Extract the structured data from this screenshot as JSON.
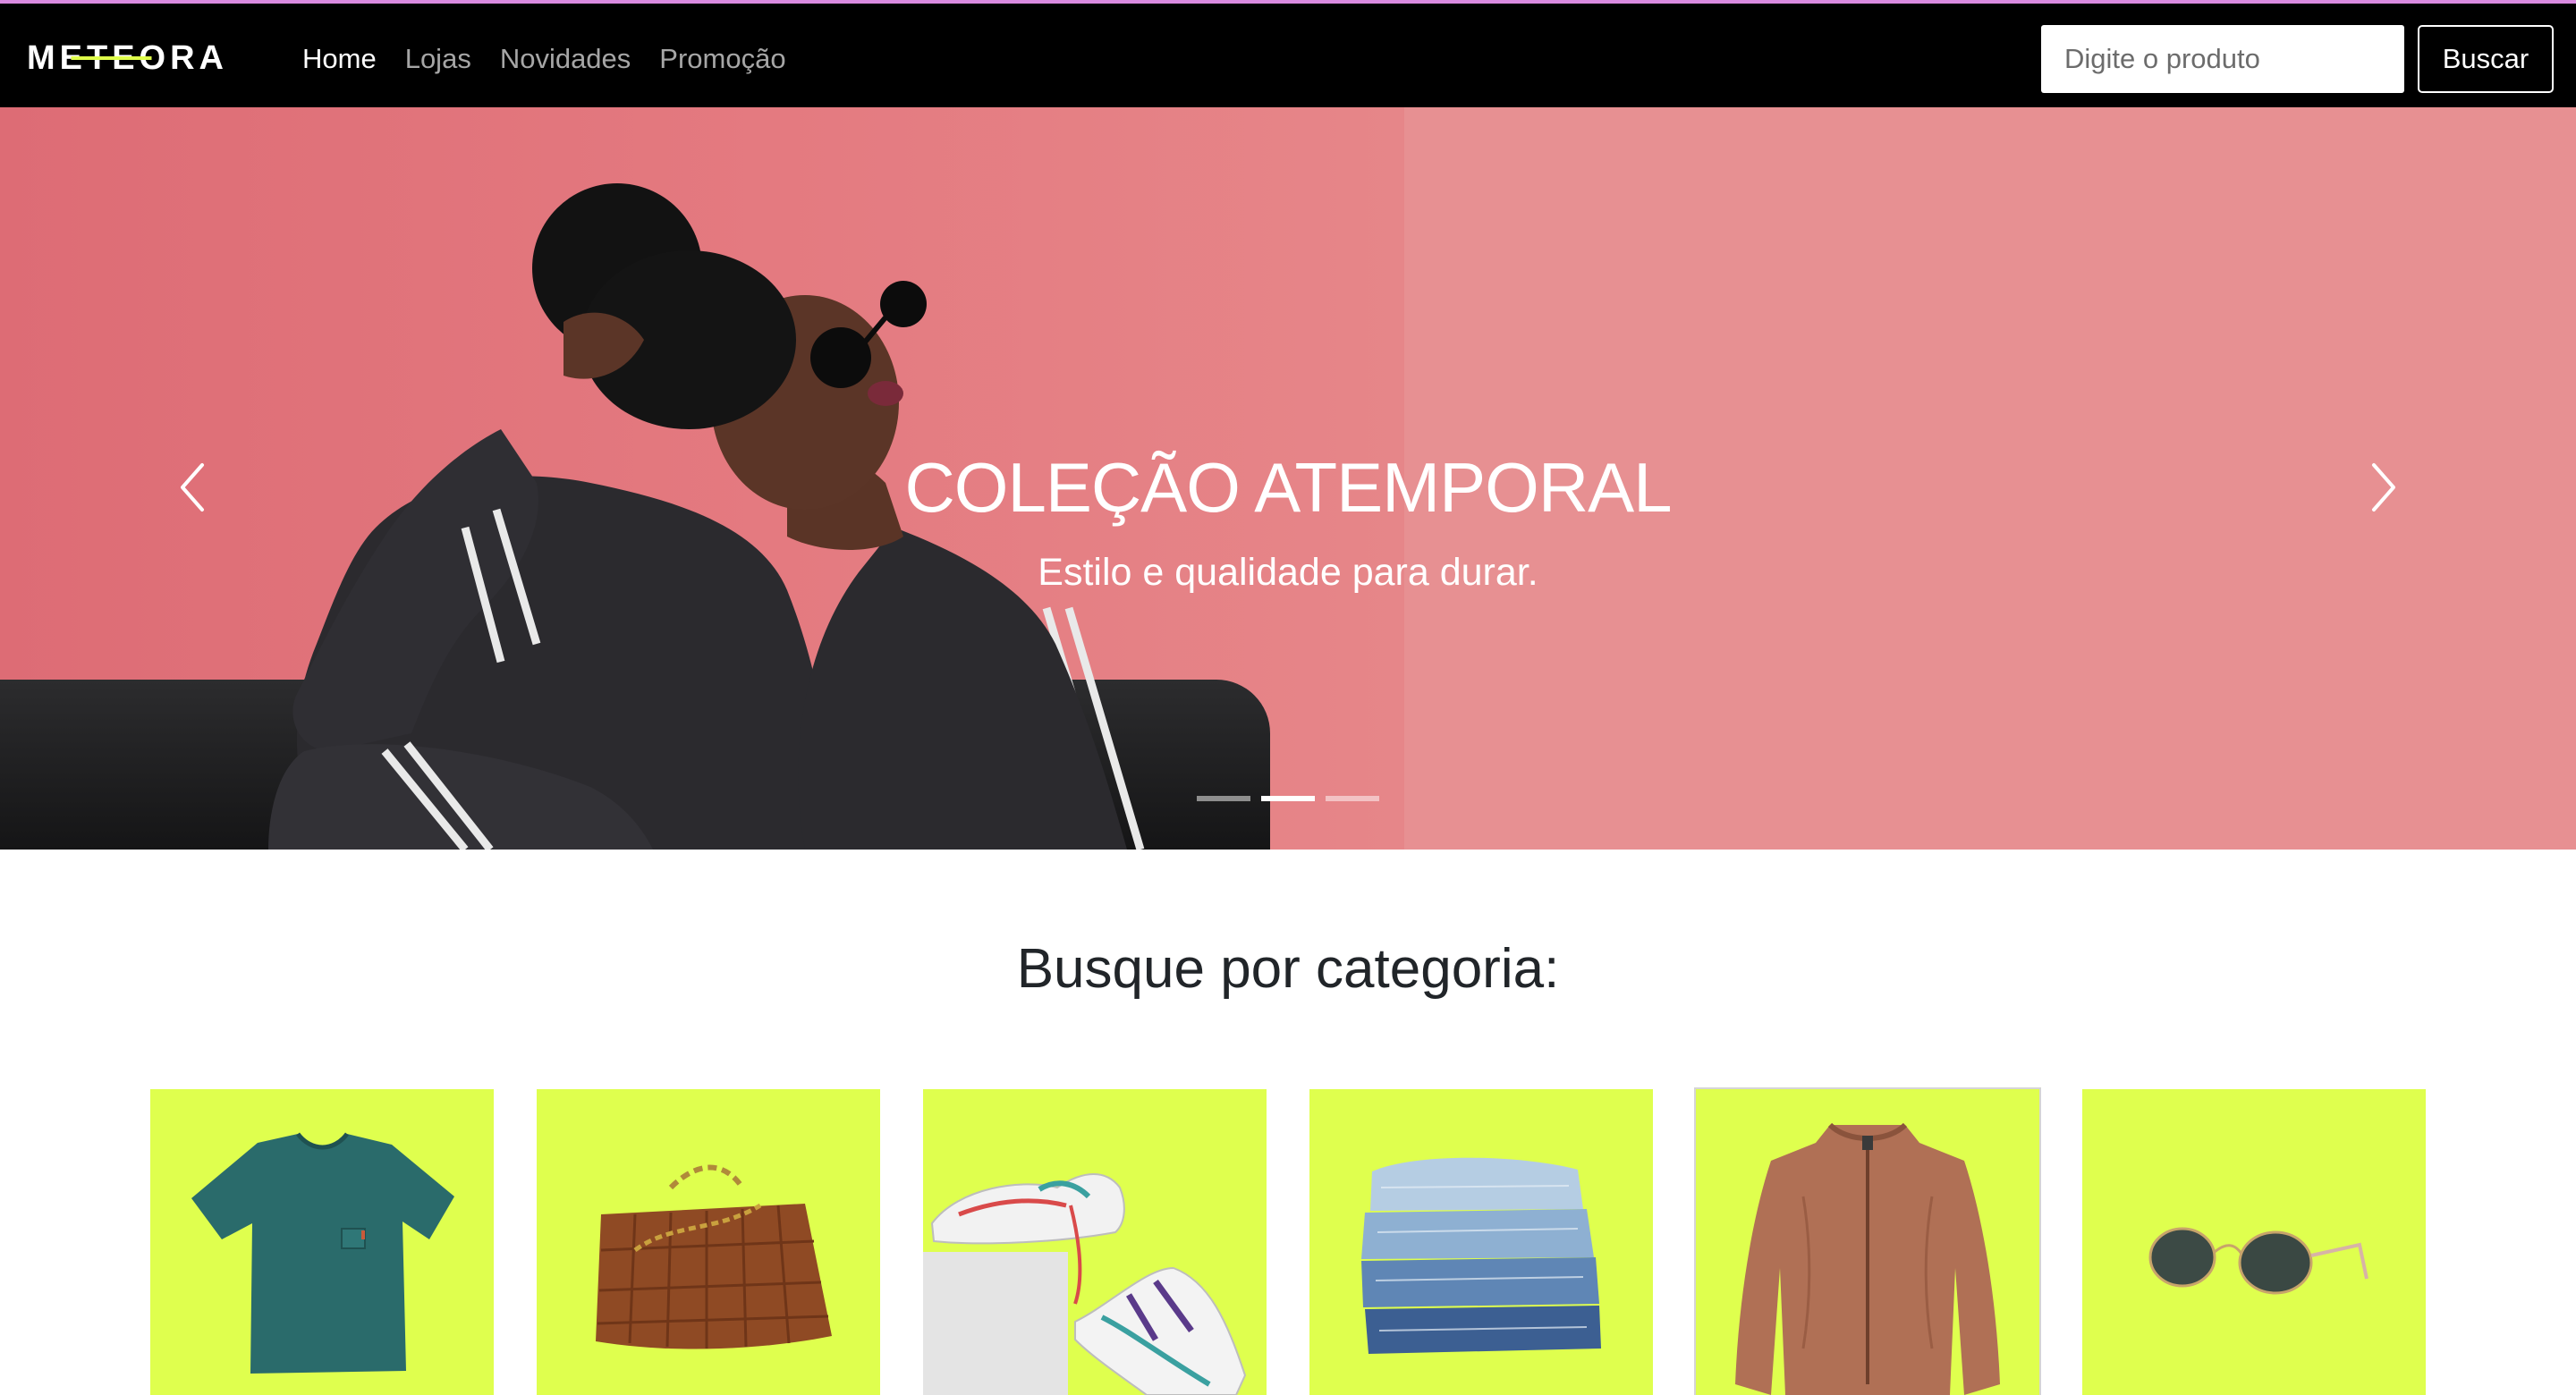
{
  "navbar": {
    "logo_text": "METEORA",
    "links": [
      {
        "label": "Home",
        "active": true
      },
      {
        "label": "Lojas",
        "active": false
      },
      {
        "label": "Novidades",
        "active": false
      },
      {
        "label": "Promoção",
        "active": false
      }
    ],
    "search": {
      "placeholder": "Digite o produto",
      "value": ""
    },
    "search_button_label": "Buscar",
    "accent_color": "#dfff4a"
  },
  "hero": {
    "title": "COLEÇÃO ATEMPORAL",
    "subtitle": "Estilo e qualidade para durar.",
    "background_color": "#e79092",
    "slides_count": 3,
    "active_slide": 2,
    "prev_icon": "chevron-left-icon",
    "next_icon": "chevron-right-icon"
  },
  "categories": {
    "title": "Busque por categoria:",
    "card_color": "#dfff4e",
    "items": [
      {
        "icon": "tshirt-icon"
      },
      {
        "icon": "handbag-icon"
      },
      {
        "icon": "sneakers-icon"
      },
      {
        "icon": "jeans-icon"
      },
      {
        "icon": "jacket-icon"
      },
      {
        "icon": "sunglasses-icon"
      }
    ]
  }
}
